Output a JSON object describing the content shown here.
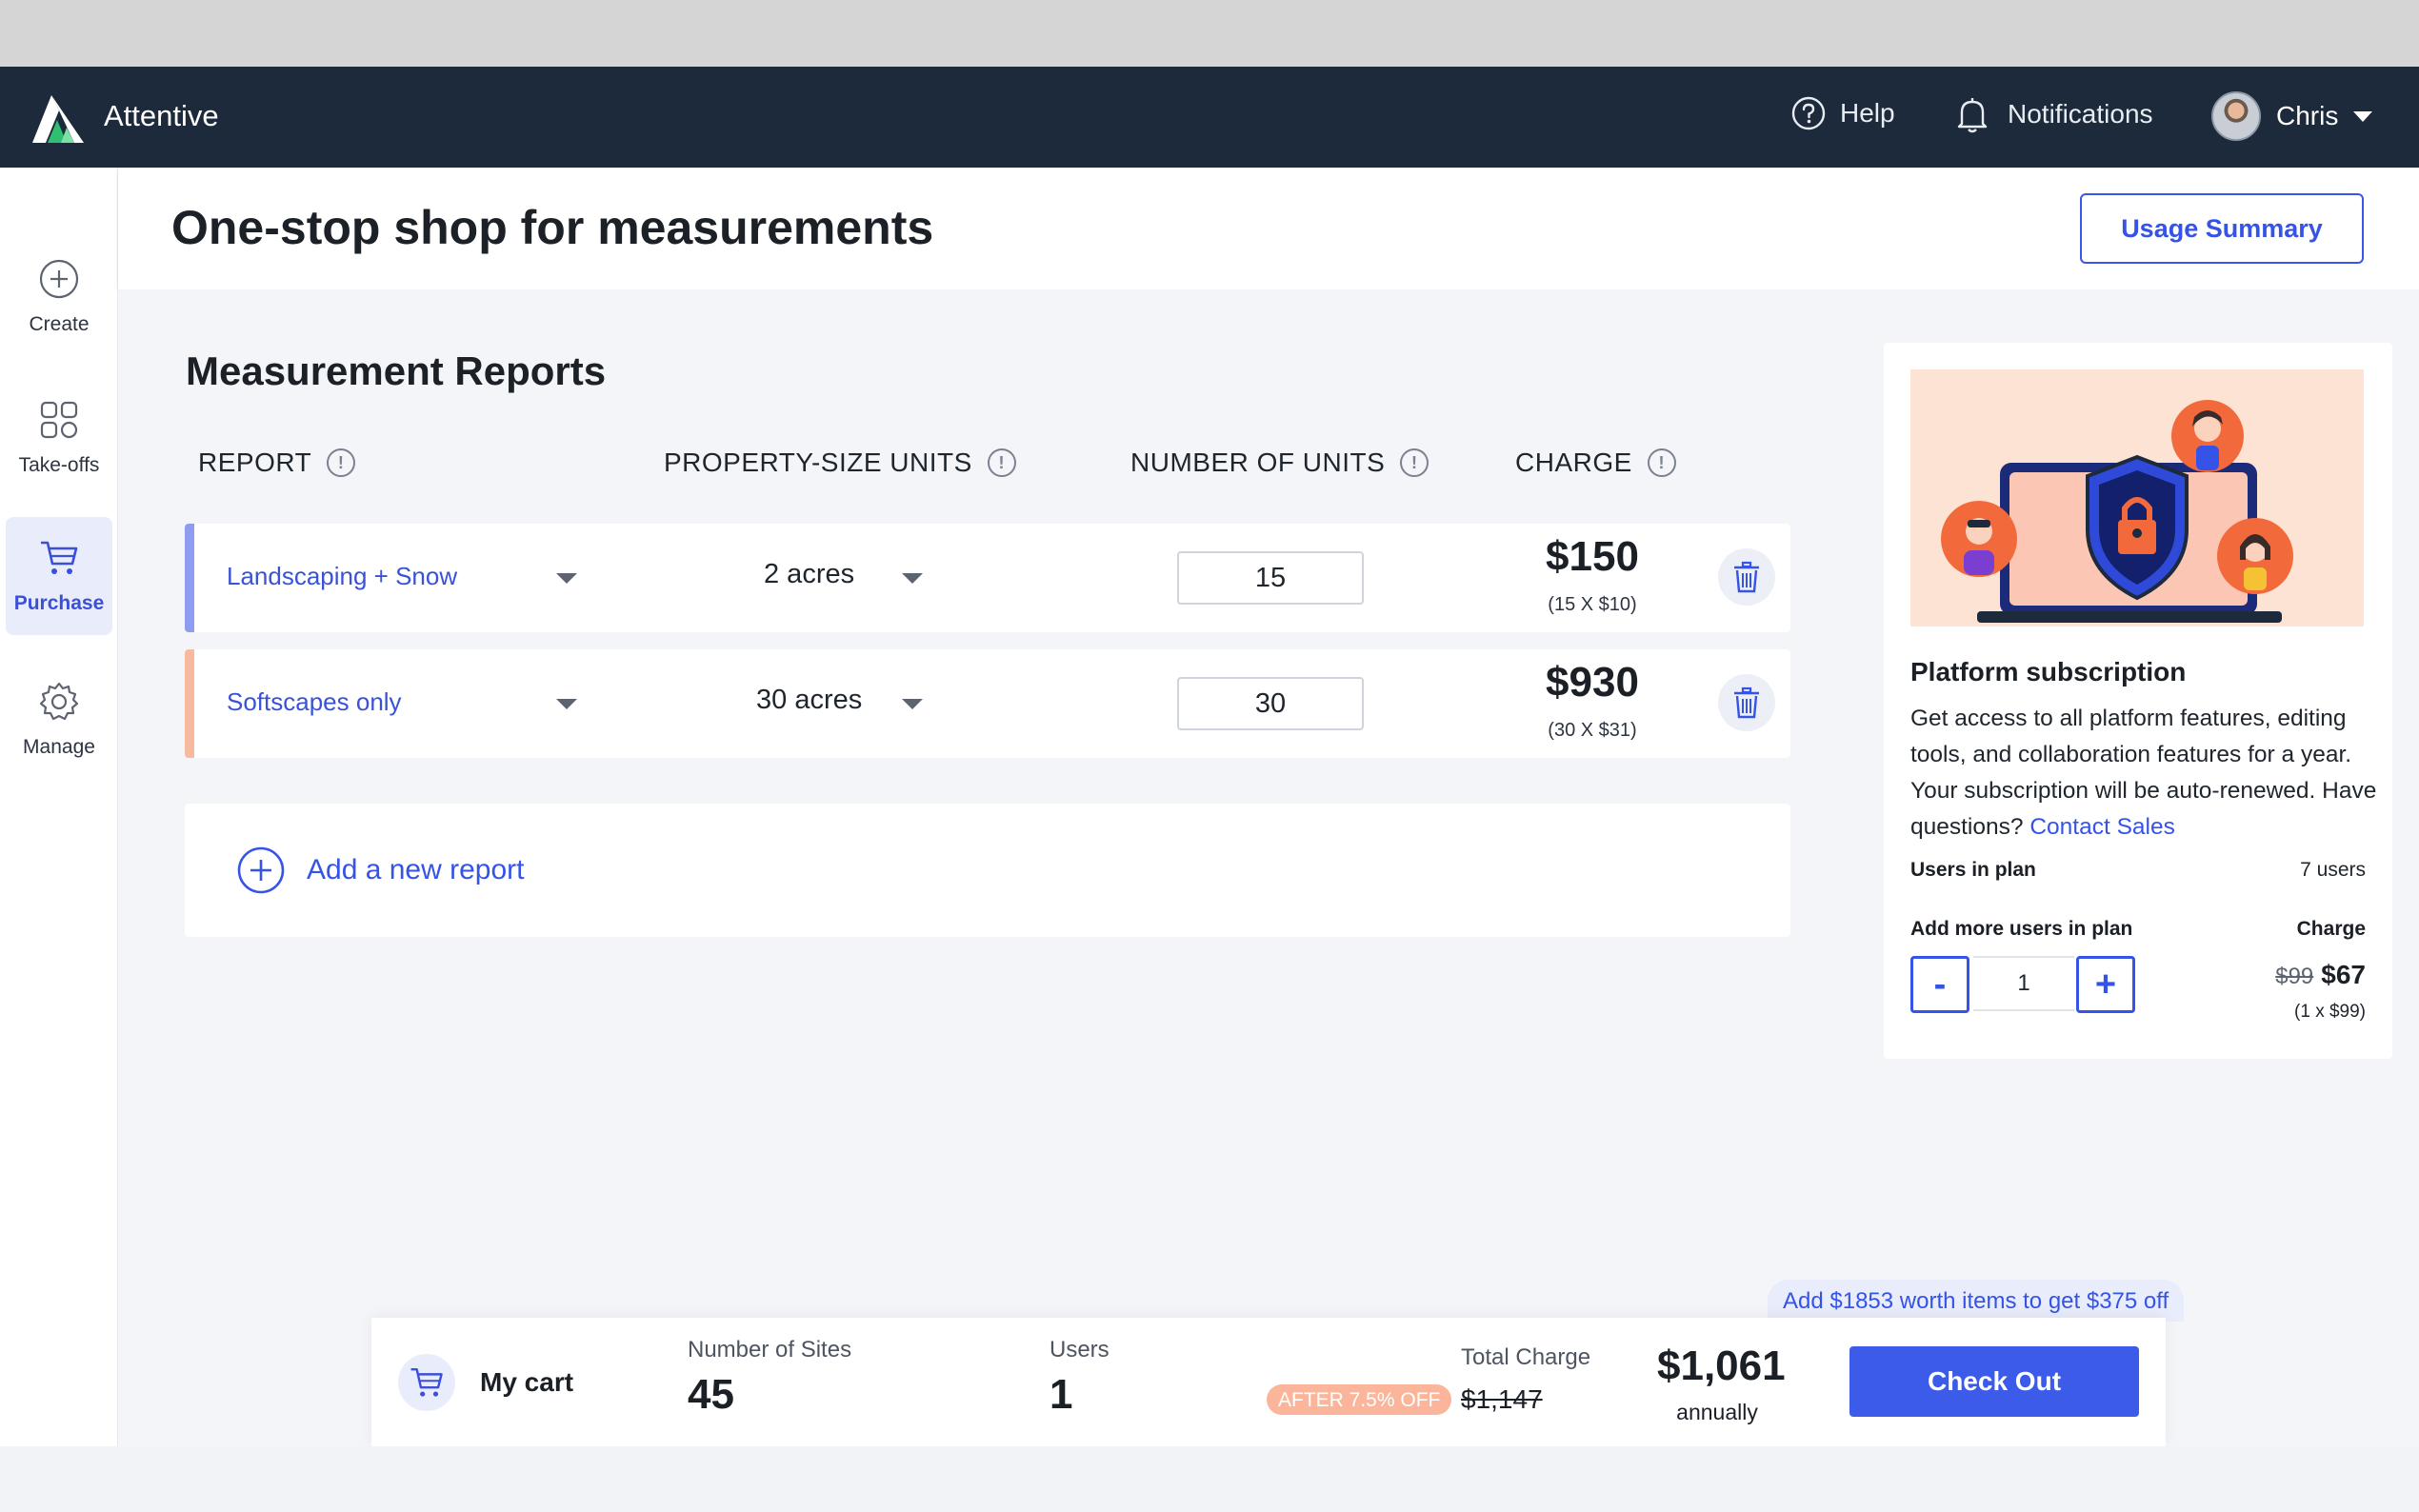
{
  "app": {
    "brand": "Attentive"
  },
  "nav": {
    "help": "Help",
    "notifications": "Notifications",
    "user_name": "Chris"
  },
  "sidebar": {
    "items": [
      {
        "label": "Create",
        "icon": "plus-circle-icon"
      },
      {
        "label": "Take-offs",
        "icon": "grid-icon"
      },
      {
        "label": "Purchase",
        "icon": "cart-icon",
        "active": true
      },
      {
        "label": "Manage",
        "icon": "gear-icon"
      }
    ]
  },
  "header": {
    "title": "One-stop shop for measurements",
    "usage_button": "Usage Summary"
  },
  "reports": {
    "title": "Measurement Reports",
    "columns": [
      "REPORT",
      "PROPERTY-SIZE UNITS",
      "NUMBER OF UNITS",
      "CHARGE"
    ],
    "rows": [
      {
        "name": "Landscaping + Snow",
        "size": "2 acres",
        "units": "15",
        "charge": "$150",
        "breakdown": "(15 X $10)",
        "accent": "#8c9df2"
      },
      {
        "name": "Softscapes only",
        "size": "30 acres",
        "units": "30",
        "charge": "$930",
        "breakdown": "(30 X $31)",
        "accent": "#f8b9a1"
      }
    ],
    "add_label": "Add a new report"
  },
  "subscription": {
    "title": "Platform subscription",
    "description": "Get access to all platform features, editing tools, and collaboration features for a year. Your subscription will be auto-renewed. Have questions?",
    "contact_link": "Contact Sales",
    "users_in_plan_label": "Users in plan",
    "users_in_plan_value": "7 users",
    "add_users_label": "Add more users in plan",
    "charge_label": "Charge",
    "stepper_minus": "-",
    "stepper_value": "1",
    "stepper_plus": "+",
    "old_price": "$99",
    "new_price": "$67",
    "price_breakdown": "(1 x $99)"
  },
  "cart": {
    "hint": "Add $1853 worth items to get $375 off",
    "title": "My cart",
    "sites_label": "Number of Sites",
    "sites_value": "45",
    "users_label": "Users",
    "users_value": "1",
    "discount_badge": "AFTER 7.5% OFF",
    "total_label": "Total Charge",
    "old_total": "$1,147",
    "new_total": "$1,061",
    "period": "annually",
    "checkout": "Check Out"
  },
  "colors": {
    "navbar": "#1c2a3b",
    "accent": "#3553e6",
    "discount": "#fbb59b"
  }
}
